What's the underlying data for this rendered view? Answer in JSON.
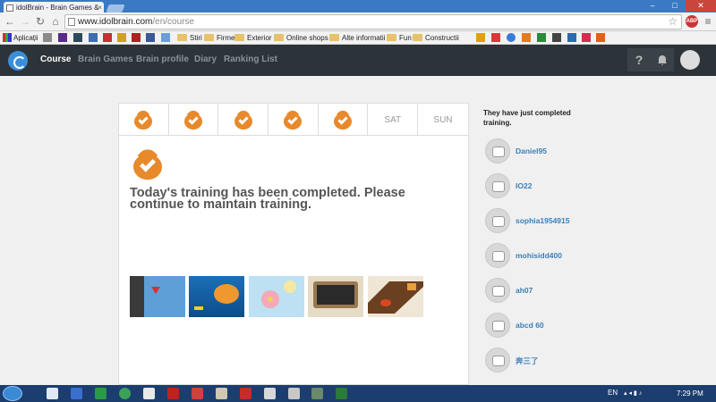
{
  "browser": {
    "tab_title": "idolBrain - Brain Games &",
    "url_host": "www.idolbrain.com",
    "url_path": "/en/course",
    "bookmarks": {
      "apps_label": "Aplicații",
      "folders": [
        "Stiri",
        "Firme",
        "Exterior",
        "Online shops",
        "Alte informatii",
        "Fun",
        "Constructii"
      ]
    }
  },
  "site_nav": {
    "items": [
      "Course",
      "Brain Games",
      "Brain profile",
      "Diary",
      "Ranking List"
    ],
    "help_label": "?"
  },
  "week": {
    "days": [
      {
        "label": "",
        "completed": true
      },
      {
        "label": "",
        "completed": true
      },
      {
        "label": "",
        "completed": true
      },
      {
        "label": "",
        "completed": true
      },
      {
        "label": "",
        "completed": true
      },
      {
        "label": "SAT",
        "completed": false
      },
      {
        "label": "SUN",
        "completed": false
      }
    ]
  },
  "training": {
    "message": "Today's training has been completed. Please continue to maintain training."
  },
  "sidebar": {
    "title": "They have just completed training.",
    "users": [
      "Daniel95",
      "IO22",
      "sophia1954915",
      "mohisidd400",
      "ah07",
      "abcd 60",
      "奔三了"
    ]
  },
  "taskbar": {
    "language": "EN",
    "time": "7:29 PM"
  },
  "colors": {
    "accent_orange": "#e8892b",
    "nav_bg": "#2c3339",
    "username_blue": "#3d7fb7"
  }
}
